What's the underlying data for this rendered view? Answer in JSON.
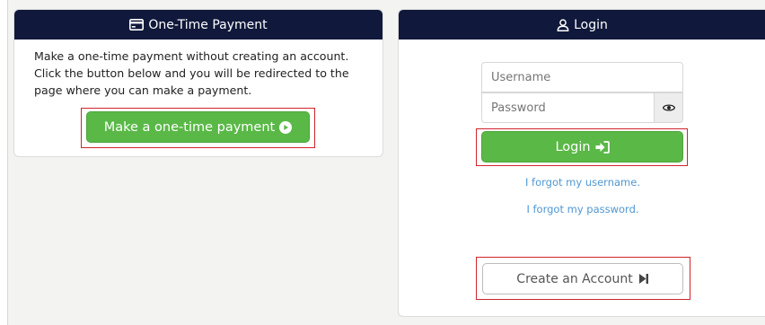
{
  "payment": {
    "title": "One-Time Payment",
    "title_icon": "credit-card-icon",
    "description": "Make a one-time payment without creating an account. Click the button below and you will be redirected to the page where you can make a payment.",
    "button_label": "Make a one-time payment",
    "button_icon": "play-circle-icon"
  },
  "login": {
    "title": "Login",
    "title_icon": "user-icon",
    "username_placeholder": "Username",
    "password_placeholder": "Password",
    "toggle_icon": "eye-icon",
    "button_label": "Login",
    "button_icon": "sign-in-icon",
    "forgot_username": "I forgot my username.",
    "forgot_password": "I forgot my password.",
    "create_account_label": "Create an Account",
    "create_account_icon": "step-forward-icon"
  },
  "colors": {
    "header_bg": "#10193b",
    "primary_green": "#5ab847",
    "link_blue": "#4f97d2",
    "highlight_red": "#d0242c"
  }
}
